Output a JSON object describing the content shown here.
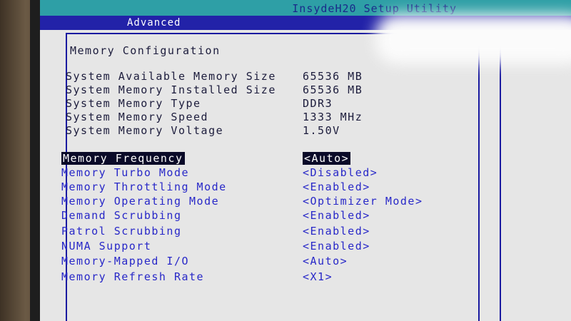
{
  "title": "InsydeH20 Setup Utility",
  "tab": "Advanced",
  "page_title": "Memory Configuration",
  "info": [
    {
      "label": "System Available Memory Size",
      "value": "65536 MB"
    },
    {
      "label": "System Memory Installed Size",
      "value": "65536 MB"
    },
    {
      "label": "System Memory Type",
      "value": "DDR3"
    },
    {
      "label": "System Memory Speed",
      "value": "1333 MHz"
    },
    {
      "label": "System Memory Voltage",
      "value": "1.50V"
    }
  ],
  "settings": [
    {
      "label": "Memory Frequency",
      "value": "<Auto>"
    },
    {
      "label": "Memory Turbo Mode",
      "value": "<Disabled>"
    },
    {
      "label": "Memory Throttling Mode",
      "value": "<Enabled>"
    },
    {
      "label": "Memory Operating Mode",
      "value": "<Optimizer Mode>"
    },
    {
      "label": "Demand Scrubbing",
      "value": "<Enabled>"
    },
    {
      "label": "Patrol Scrubbing",
      "value": "<Enabled>"
    },
    {
      "label": "NUMA Support",
      "value": "<Enabled>"
    },
    {
      "label": "Memory-Mapped I/O",
      "value": "<Auto>"
    },
    {
      "label": "Memory Refresh Rate",
      "value": "<X1>"
    }
  ],
  "colors": {
    "title_bar": "#2e9fa6",
    "tab_bar": "#2222a8",
    "selected_bg": "#0a0a28",
    "option_text": "#2828c8",
    "static_text": "#1c1c3c"
  }
}
